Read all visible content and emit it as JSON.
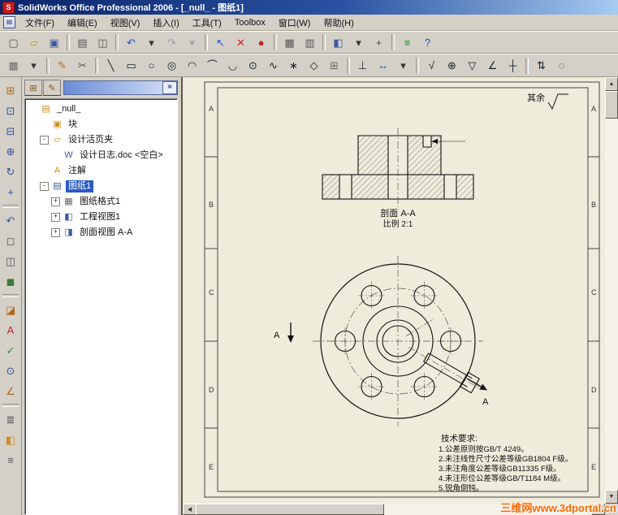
{
  "window": {
    "title": "SolidWorks Office Professional 2006 - [_null_ - 图纸1]"
  },
  "menu": {
    "items": [
      {
        "name": "menu-file",
        "label": "文件(F)"
      },
      {
        "name": "menu-edit",
        "label": "编辑(E)"
      },
      {
        "name": "menu-view",
        "label": "视图(V)"
      },
      {
        "name": "menu-insert",
        "label": "插入(I)"
      },
      {
        "name": "menu-tools",
        "label": "工具(T)"
      },
      {
        "name": "menu-toolbox",
        "label": "Toolbox"
      },
      {
        "name": "menu-window",
        "label": "窗口(W)"
      },
      {
        "name": "menu-help",
        "label": "帮助(H)"
      }
    ]
  },
  "toolbar_main": {
    "items": [
      {
        "name": "new-icon",
        "glyph": "▢",
        "color": "#555555"
      },
      {
        "name": "open-icon",
        "glyph": "▱",
        "color": "#c89020"
      },
      {
        "name": "save-icon",
        "glyph": "▣",
        "color": "#3a5a9c"
      },
      {
        "type": "sep",
        "name": "toolbar-separator"
      },
      {
        "name": "print-icon",
        "glyph": "▤",
        "color": "#555555"
      },
      {
        "name": "print-preview-icon",
        "glyph": "◫",
        "color": "#555555"
      },
      {
        "type": "sep",
        "name": "toolbar-separator"
      },
      {
        "name": "undo-icon",
        "glyph": "↶",
        "color": "#1a54c8"
      },
      {
        "name": "undo-dropdown-icon",
        "glyph": "▾",
        "color": "#333333"
      },
      {
        "name": "redo-icon",
        "glyph": "↷",
        "color": "#9aa0a8"
      },
      {
        "name": "redo-dropdown-icon",
        "glyph": "▾",
        "color": "#9aa0a8"
      },
      {
        "type": "sep",
        "name": "toolbar-separator"
      },
      {
        "name": "select-icon",
        "glyph": "↖",
        "color": "#1a54c8"
      },
      {
        "name": "delete-icon",
        "glyph": "✕",
        "color": "#cc2020"
      },
      {
        "name": "rebuild-stoplight-icon",
        "glyph": "●",
        "color": "#d02020"
      },
      {
        "type": "sep",
        "name": "toolbar-separator"
      },
      {
        "name": "sheet-properties-icon",
        "glyph": "▦",
        "color": "#555555"
      },
      {
        "name": "tables-icon",
        "glyph": "▥",
        "color": "#555555"
      },
      {
        "type": "sep",
        "name": "toolbar-separator"
      },
      {
        "name": "view-mode-icon",
        "glyph": "◧",
        "color": "#3a5a9c"
      },
      {
        "name": "view-mode-dropdown-icon",
        "glyph": "▾",
        "color": "#333333"
      },
      {
        "name": "pan-icon",
        "glyph": "+",
        "color": "#555555"
      },
      {
        "type": "sep",
        "name": "toolbar-separator"
      },
      {
        "name": "comment-icon",
        "glyph": "≡",
        "color": "#2c8a2c"
      },
      {
        "name": "help-icon",
        "glyph": "?",
        "color": "#1a54c8"
      }
    ]
  },
  "toolbar_sketch": {
    "items": [
      {
        "name": "sheet-format-icon",
        "glyph": "▦",
        "color": "#6a6a6a"
      },
      {
        "name": "sheet-format-dropdown-icon",
        "glyph": "▾",
        "color": "#333333"
      },
      {
        "type": "sep",
        "name": "toolbar-separator"
      },
      {
        "name": "sketch-icon",
        "glyph": "✎",
        "color": "#b06a1a"
      },
      {
        "name": "trim-icon",
        "glyph": "✂",
        "color": "#555555"
      },
      {
        "type": "sep",
        "name": "toolbar-separator"
      },
      {
        "name": "line-icon",
        "glyph": "╲",
        "color": "#16212e"
      },
      {
        "name": "rectangle-icon",
        "glyph": "▭",
        "color": "#16212e"
      },
      {
        "name": "circle-icon",
        "glyph": "○",
        "color": "#16212e"
      },
      {
        "name": "perimeter-circle-icon",
        "glyph": "◎",
        "color": "#16212e"
      },
      {
        "name": "centerpoint-arc-icon",
        "glyph": "◠",
        "color": "#16212e"
      },
      {
        "name": "tangent-arc-icon",
        "glyph": "⌒",
        "color": "#16212e"
      },
      {
        "name": "three-point-arc-icon",
        "glyph": "◡",
        "color": "#16212e"
      },
      {
        "name": "ellipse-icon",
        "glyph": "⊙",
        "color": "#16212e"
      },
      {
        "name": "spline-icon",
        "glyph": "∿",
        "color": "#16212e"
      },
      {
        "name": "point-icon",
        "glyph": "∗",
        "color": "#16212e"
      },
      {
        "name": "polygon-icon",
        "glyph": "◇",
        "color": "#16212e"
      },
      {
        "name": "grid-icon",
        "glyph": "⊞",
        "color": "#6a6a6a"
      },
      {
        "type": "sep",
        "name": "toolbar-separator"
      },
      {
        "name": "anchor-icon",
        "glyph": "⊥",
        "color": "#16212e"
      },
      {
        "name": "smart-dimension-icon",
        "glyph": "↔",
        "color": "#1a54c8"
      },
      {
        "name": "dimension-dropdown-icon",
        "glyph": "▾",
        "color": "#333333"
      },
      {
        "type": "sep",
        "name": "toolbar-separator"
      },
      {
        "name": "surface-finish-icon",
        "glyph": "√",
        "color": "#16212e"
      },
      {
        "name": "geometric-tolerance-icon",
        "glyph": "⊕",
        "color": "#16212e"
      },
      {
        "name": "datum-feature-icon",
        "glyph": "▽",
        "color": "#16212e"
      },
      {
        "name": "weld-symbol-icon",
        "glyph": "∠",
        "color": "#16212e"
      },
      {
        "name": "centerline-icon",
        "glyph": "┼",
        "color": "#16212e"
      },
      {
        "type": "sep",
        "name": "toolbar-separator"
      },
      {
        "name": "section-line-icon",
        "glyph": "⇅",
        "color": "#16212e"
      },
      {
        "name": "detail-circle-icon",
        "glyph": "◌",
        "color": "#16212e"
      }
    ]
  },
  "toolbar_left": {
    "items": [
      {
        "name": "view-orientation-icon",
        "glyph": "⊞",
        "color": "#b06a1a"
      },
      {
        "name": "zoom-fit-icon",
        "glyph": "⊡",
        "color": "#33539c"
      },
      {
        "name": "zoom-area-icon",
        "glyph": "⊟",
        "color": "#33539c"
      },
      {
        "name": "zoom-in-out-icon",
        "glyph": "⊕",
        "color": "#33539c"
      },
      {
        "name": "rotate-view-icon",
        "glyph": "↻",
        "color": "#33539c"
      },
      {
        "name": "pan-view-icon",
        "glyph": "+",
        "color": "#33539c"
      },
      {
        "type": "sep",
        "name": "toolbar-separator"
      },
      {
        "name": "previous-view-icon",
        "glyph": "↶",
        "color": "#33539c"
      },
      {
        "name": "wireframe-icon",
        "glyph": "◻",
        "color": "#555555"
      },
      {
        "name": "hidden-lines-icon",
        "glyph": "◫",
        "color": "#555555"
      },
      {
        "name": "shaded-icon",
        "glyph": "◼",
        "color": "#3a7a3a"
      },
      {
        "type": "sep",
        "name": "toolbar-separator"
      },
      {
        "name": "section-view-icon",
        "glyph": "◪",
        "color": "#b06a1a"
      },
      {
        "name": "note-icon",
        "glyph": "A",
        "color": "#cc2020"
      },
      {
        "name": "spell-check-icon",
        "glyph": "✓",
        "color": "#2c8a2c"
      },
      {
        "name": "magnifier-icon",
        "glyph": "⊙",
        "color": "#33539c"
      },
      {
        "name": "measure-icon",
        "glyph": "∠",
        "color": "#b06a1a"
      },
      {
        "type": "sep",
        "name": "toolbar-separator"
      },
      {
        "name": "layer-properties-icon",
        "glyph": "≣",
        "color": "#555555"
      },
      {
        "name": "color-swatch-icon",
        "glyph": "◧",
        "color": "#cc8a2a"
      },
      {
        "name": "line-style-icon",
        "glyph": "≡",
        "color": "#555555"
      }
    ]
  },
  "panel": {
    "collapse_glyph": "»",
    "tabs": [
      {
        "name": "featuremanager-tab",
        "glyph": "⊞"
      },
      {
        "name": "displaypane-tab",
        "glyph": "✎"
      }
    ]
  },
  "feature_tree": {
    "items": [
      {
        "name": "tree-item-null",
        "label": "_null_",
        "level": 0,
        "expand": "",
        "glyph": "▤",
        "icon": "ic-gold"
      },
      {
        "name": "tree-item-blocks",
        "label": "块",
        "level": 1,
        "expand": "",
        "glyph": "▣",
        "icon": "ic-gold"
      },
      {
        "name": "tree-item-design-binder",
        "label": "设计活页夹",
        "level": 1,
        "expand": "-",
        "glyph": "▱",
        "icon": "ic-gold"
      },
      {
        "name": "tree-item-design-journal",
        "label": "设计日志.doc <空白>",
        "level": 2,
        "expand": "",
        "glyph": "W",
        "icon": "ic-blue"
      },
      {
        "name": "tree-item-annotations",
        "label": "注解",
        "level": 1,
        "expand": "",
        "glyph": "A",
        "icon": "ic-gold"
      },
      {
        "name": "tree-item-sheet1",
        "label": "图纸1",
        "level": 1,
        "expand": "-",
        "glyph": "▤",
        "icon": "ic-blue",
        "selected": true
      },
      {
        "name": "tree-item-sheet-format1",
        "label": "图纸格式1",
        "level": 2,
        "expand": "+",
        "glyph": "▦",
        "icon": "ic-gray"
      },
      {
        "name": "tree-item-drawing-view1",
        "label": "工程视图1",
        "level": 2,
        "expand": "+",
        "glyph": "◧",
        "icon": "ic-blue"
      },
      {
        "name": "tree-item-section-view-aa",
        "label": "剖面视图 A-A",
        "level": 2,
        "expand": "+",
        "glyph": "◨",
        "icon": "ic-blue"
      }
    ]
  },
  "drawing": {
    "zone_labels": [
      "A",
      "B",
      "C",
      "D",
      "E"
    ],
    "surface_note": "其余",
    "section_label": "剖面 A-A",
    "scale_label": "比例 2:1",
    "section_arrow_label": "A",
    "tech_requirements": {
      "title": "技术要求:",
      "items": [
        "1.公差原则按GB/T 4249。",
        "2.未注线性尺寸公差等级GB1804 F级。",
        "3.未注角度公差等级GB11335 F级。",
        "4.未注形位公差等级GB/T1184 M级。",
        "5.锐角倒钝。"
      ]
    }
  },
  "watermark": {
    "text": "三维网www.3dportal.cn"
  }
}
